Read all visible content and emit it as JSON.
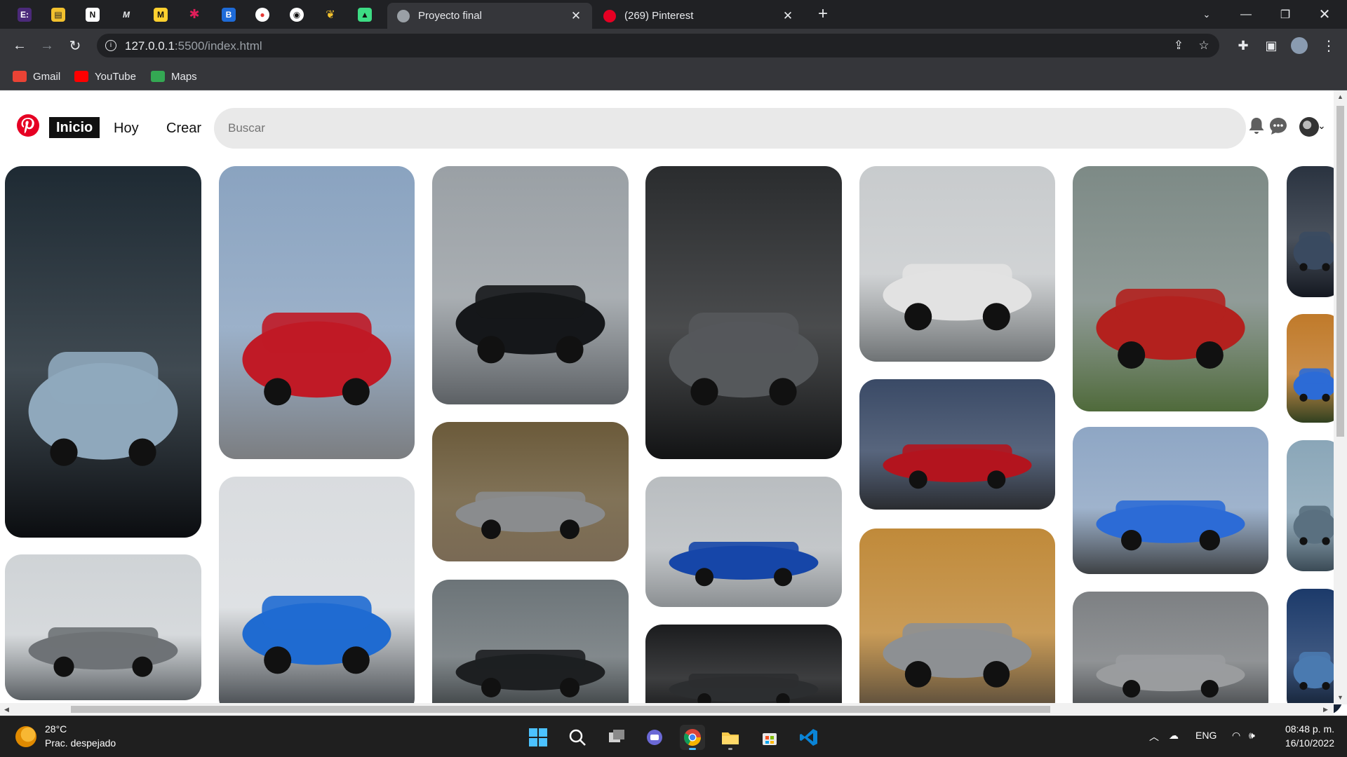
{
  "browser": {
    "pinned_tabs": [
      {
        "name": "figma-ish",
        "color": "#4b2a7a",
        "glyph": "E:"
      },
      {
        "name": "docs",
        "color": "#f2c12e",
        "glyph": "▤"
      },
      {
        "name": "notion",
        "color": "#ffffff",
        "glyph": "N"
      },
      {
        "name": "medium",
        "color": "#202124",
        "glyph": "M"
      },
      {
        "name": "miro",
        "color": "#ffd02f",
        "glyph": "M"
      },
      {
        "name": "slack",
        "color": "#202124",
        "glyph": "✱"
      },
      {
        "name": "trello",
        "color": "#202124",
        "glyph": "B"
      },
      {
        "name": "record",
        "color": "#ffffff",
        "glyph": "●"
      },
      {
        "name": "github",
        "color": "#202124",
        "glyph": "◉"
      },
      {
        "name": "medal",
        "color": "#202124",
        "glyph": "❦"
      },
      {
        "name": "android",
        "color": "#202124",
        "glyph": "▲"
      }
    ],
    "tabs": [
      {
        "title": "Proyecto final",
        "active": true
      },
      {
        "title": "(269) Pinterest",
        "active": false
      }
    ],
    "url_host": "127.0.0.1",
    "url_rest": ":5500/index.html",
    "bookmarks": [
      {
        "label": "Gmail",
        "color": "#ea4335"
      },
      {
        "label": "YouTube",
        "color": "#ff0000"
      },
      {
        "label": "Maps",
        "color": "#34a853"
      }
    ]
  },
  "pinterest": {
    "nav": {
      "home": "Inicio",
      "today": "Hoy",
      "create": "Crear"
    },
    "search_placeholder": "Buscar",
    "pins": [
      {
        "name": "pin-porsche-blue-headlight",
        "sky": "#1e2a33",
        "ground": "#0b0d10",
        "car": "#8fa8bc"
      },
      {
        "name": "pin-porsche-grey-rocars",
        "sky": "#cfd3d6",
        "ground": "#5a5f63",
        "car": "#6e7276"
      },
      {
        "name": "pin-porsche-red-sunset",
        "sky": "#8aa3c0",
        "ground": "#7b7d80",
        "car": "#c01a26"
      },
      {
        "name": "pin-porsche-blue-gt3",
        "sky": "#d9dcdf",
        "ground": "#3a3f44",
        "car": "#1f6bd1"
      },
      {
        "name": "pin-rwb-black",
        "sky": "#9aa0a5",
        "ground": "#5c6064",
        "car": "#15171a"
      },
      {
        "name": "pin-bmw-m2-grey",
        "sky": "#6b5a3a",
        "ground": "#7a6a55",
        "car": "#8a8c8e"
      },
      {
        "name": "pin-mountain-car",
        "sky": "#6c7478",
        "ground": "#2e3234",
        "car": "#1d1f21"
      },
      {
        "name": "pin-porsche-918",
        "sky": "#2a2c2e",
        "ground": "#121314",
        "car": "#55585b"
      },
      {
        "name": "pin-bmw-m2-track",
        "sky": "#b9bdc0",
        "ground": "#8a8e91",
        "car": "#1646a8"
      },
      {
        "name": "pin-dark-garage",
        "sky": "#1b1c1e",
        "ground": "#0e0f10",
        "car": "#2c2e30"
      },
      {
        "name": "pin-gtr-white",
        "sky": "#c8cbcd",
        "ground": "#6e7274",
        "car": "#e2e2e2"
      },
      {
        "name": "pin-lfa-red",
        "sky": "#3a4a66",
        "ground": "#2a2c30",
        "car": "#b3141e"
      },
      {
        "name": "pin-gtr-grey-autumn",
        "sky": "#c08a3a",
        "ground": "#4a4238",
        "car": "#8d9093"
      },
      {
        "name": "pin-bmw-e24-red",
        "sky": "#7d8a86",
        "ground": "#4f6a3a",
        "car": "#b3211e"
      },
      {
        "name": "pin-bmw-m2-blue",
        "sky": "#8ea6c4",
        "ground": "#3d4043",
        "car": "#2c6bd6"
      },
      {
        "name": "pin-rocks",
        "sky": "#7d8083",
        "ground": "#3a3d40",
        "car": "#9a9c9e"
      },
      {
        "name": "pin-edge-1",
        "sky": "#2a3340",
        "ground": "#141820",
        "car": "#3a4a60"
      },
      {
        "name": "pin-edge-2",
        "sky": "#c07a2a",
        "ground": "#304020",
        "car": "#2c6bd6"
      },
      {
        "name": "pin-edge-3",
        "sky": "#8aa6b8",
        "ground": "#3a4a55",
        "car": "#5a7080"
      },
      {
        "name": "pin-edge-4",
        "sky": "#1c3a6a",
        "ground": "#0f1a2a",
        "car": "#4a7ab0"
      }
    ]
  },
  "taskbar": {
    "temp": "28°C",
    "weather": "Prac. despejado",
    "lang": "ENG",
    "time": "08:48 p. m.",
    "date": "16/10/2022"
  }
}
